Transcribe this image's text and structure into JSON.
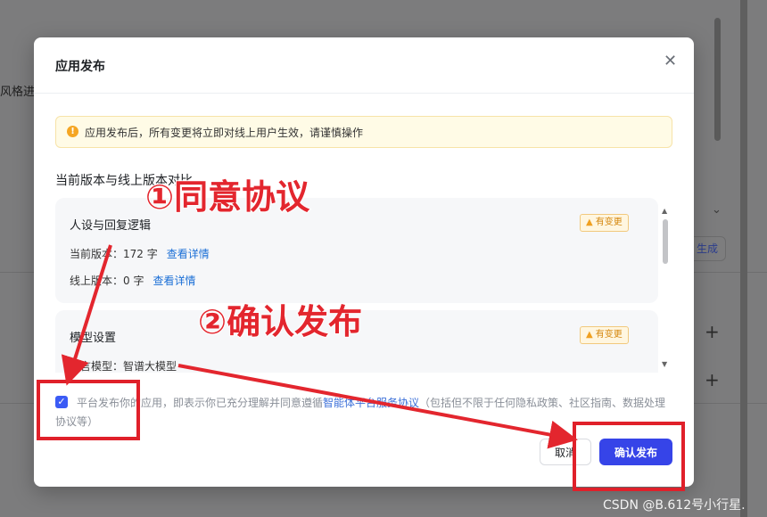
{
  "background": {
    "side_text": "风格进",
    "generate_label": "生成",
    "plus_glyph": "+",
    "chevron_glyph": "⌄"
  },
  "modal": {
    "title": "应用发布",
    "close_glyph": "✕",
    "alert": {
      "icon": "!",
      "text": "应用发布后，所有变更将立即对线上用户生效，请谨慎操作"
    },
    "section_title": "当前版本与线上版本对比",
    "cards": [
      {
        "title": "人设与回复逻辑",
        "badge": "有变更",
        "current": {
          "label": "当前版本：172 字",
          "link": "查看详情"
        },
        "online": {
          "label": "线上版本：0 字",
          "link": "查看详情"
        }
      },
      {
        "title": "模型设置",
        "badge": "有变更",
        "model_line": "语言模型：智谱大模型"
      }
    ],
    "agreement": {
      "checked_glyph": "✓",
      "prefix": "平台发布你的应用，即表示你已充分理解并同意遵循",
      "link": "智能体平台服务协议",
      "suffix": "（包括但不限于任何隐私政策、社区指南、数据处理协议等）"
    },
    "cancel_label": "取消",
    "confirm_label": "确认发布"
  },
  "annotations": {
    "step1": "①同意协议",
    "step2": "②确认发布",
    "color": "#e3262e"
  },
  "watermark": "CSDN @B.612号小行星."
}
